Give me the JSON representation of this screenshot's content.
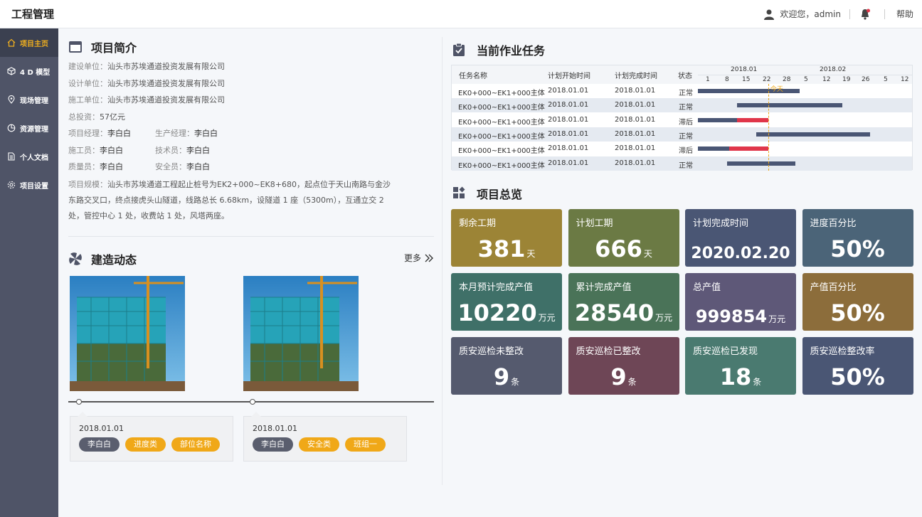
{
  "header": {
    "app_title": "工程管理",
    "welcome": "欢迎您，admin",
    "help": "帮助"
  },
  "sidebar": {
    "items": [
      {
        "label": "项目主页",
        "icon": "home-icon",
        "active": true
      },
      {
        "label": "4 D 模型",
        "icon": "cube-icon",
        "active": false
      },
      {
        "label": "现场管理",
        "icon": "location-icon",
        "active": false
      },
      {
        "label": "资源管理",
        "icon": "pie-chart-icon",
        "active": false
      },
      {
        "label": "个人文档",
        "icon": "document-icon",
        "active": false
      },
      {
        "label": "项目设置",
        "icon": "gear-icon",
        "active": false
      }
    ]
  },
  "intro": {
    "title": "项目简介",
    "build_unit": {
      "label": "建设单位：",
      "value": "汕头市苏埃通道投资发展有限公司"
    },
    "design_unit": {
      "label": "设计单位：",
      "value": "汕头市苏埃通道投资发展有限公司"
    },
    "construct_unit": {
      "label": "施工单位：",
      "value": "汕头市苏埃通道投资发展有限公司"
    },
    "investment": {
      "label": "总投资：",
      "value": "57亿元"
    },
    "staff": [
      [
        {
          "label": "项目经理：",
          "value": "李白白"
        },
        {
          "label": "生产经理：",
          "value": "李白白"
        }
      ],
      [
        {
          "label": "施工员：",
          "value": "李白白"
        },
        {
          "label": "技术员：",
          "value": "李白白"
        }
      ],
      [
        {
          "label": "质量员：",
          "value": "李白白"
        },
        {
          "label": "安全员：",
          "value": "李白白"
        }
      ]
    ],
    "scale_label": "项目规模：",
    "scale_value": "汕头市苏埃通道工程起止桩号为EK2+000~EK8+680，起点位于天山南路与金沙东路交叉口，终点接虎头山隧道，线路总长 6.68km，设隧道 1 座（5300m），互通立交 2 处，管控中心 1 处，收费站 1 处，风塔两座。"
  },
  "news": {
    "title": "建造动态",
    "more": "更多",
    "items": [
      {
        "date": "2018.01.01",
        "person": "李白白",
        "tags": [
          "进度类",
          "部位名称"
        ]
      },
      {
        "date": "2018.01.01",
        "person": "李白白",
        "tags": [
          "安全类",
          "班组一"
        ]
      }
    ]
  },
  "tasks": {
    "title": "当前作业任务",
    "columns": [
      "任务名称",
      "计划开始时间",
      "计划完成时间",
      "状态"
    ],
    "months": [
      "2018.01",
      "2018.02"
    ],
    "days": [
      "1",
      "8",
      "15",
      "22",
      "28",
      "5",
      "12",
      "19",
      "26",
      "5",
      "12"
    ],
    "today_label": "今天",
    "today_day_index": 3.6,
    "rows": [
      {
        "name": "EK0+000~EK1+000主体",
        "start": "2018.01.01",
        "end": "2018.01.01",
        "status": "正常",
        "bar_start": 0,
        "bar_end": 5.2,
        "late_start": null,
        "late_end": null
      },
      {
        "name": "EK0+000~EK1+000主体",
        "start": "2018.01.01",
        "end": "2018.01.01",
        "status": "正常",
        "bar_start": 2.0,
        "bar_end": 7.4,
        "late_start": null,
        "late_end": null
      },
      {
        "name": "EK0+000~EK1+000主体",
        "start": "2018.01.01",
        "end": "2018.01.01",
        "status": "滞后",
        "bar_start": 0,
        "bar_end": 3.6,
        "late_start": 2.0,
        "late_end": 3.6
      },
      {
        "name": "EK0+000~EK1+000主体",
        "start": "2018.01.01",
        "end": "2018.01.01",
        "status": "正常",
        "bar_start": 3.0,
        "bar_end": 8.8,
        "late_start": null,
        "late_end": null
      },
      {
        "name": "EK0+000~EK1+000主体",
        "start": "2018.01.01",
        "end": "2018.01.01",
        "status": "滞后",
        "bar_start": 0,
        "bar_end": 3.6,
        "late_start": 1.6,
        "late_end": 3.6
      },
      {
        "name": "EK0+000~EK1+000主体",
        "start": "2018.01.01",
        "end": "2018.01.01",
        "status": "正常",
        "bar_start": 1.5,
        "bar_end": 5.0,
        "late_start": null,
        "late_end": null
      }
    ]
  },
  "overview": {
    "title": "项目总览",
    "cards": [
      {
        "label": "剩余工期",
        "value": "381",
        "unit": "天",
        "color": "#9c8436"
      },
      {
        "label": "计划工期",
        "value": "666",
        "unit": "天",
        "color": "#6b7a44"
      },
      {
        "label": "计划完成时间",
        "value": "2020.02.20",
        "unit": "",
        "color": "#4a5674"
      },
      {
        "label": "进度百分比",
        "value": "50%",
        "unit": "",
        "color": "#4b6478"
      },
      {
        "label": "本月预计完成产值",
        "value": "10220",
        "unit": "万元",
        "color": "#3f7068"
      },
      {
        "label": "累计完成产值",
        "value": "28540",
        "unit": "万元",
        "color": "#4a7358"
      },
      {
        "label": "总产值",
        "value": "999854",
        "unit": "万元",
        "color": "#5e5878"
      },
      {
        "label": "产值百分比",
        "value": "50%",
        "unit": "",
        "color": "#8c6d3b"
      },
      {
        "label": "质安巡检未整改",
        "value": "9",
        "unit": "条",
        "color": "#555a6e"
      },
      {
        "label": "质安巡检已整改",
        "value": "9",
        "unit": "条",
        "color": "#6e4656"
      },
      {
        "label": "质安巡检已发现",
        "value": "18",
        "unit": "条",
        "color": "#4a7a70"
      },
      {
        "label": "质安巡检整改率",
        "value": "50%",
        "unit": "",
        "color": "#4a5674"
      }
    ]
  }
}
